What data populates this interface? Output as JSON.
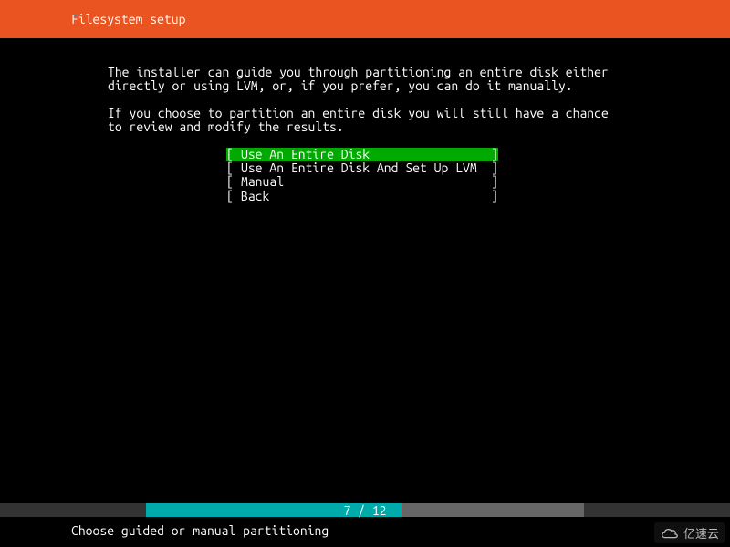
{
  "header": {
    "title": "Filesystem setup"
  },
  "body": {
    "para1": "The installer can guide you through partitioning an entire disk either\ndirectly or using LVM, or, if you prefer, you can do it manually.",
    "para2": "If you choose to partition an entire disk you will still have a chance\nto review and modify the results."
  },
  "menu": {
    "items": [
      {
        "label": "Use An Entire Disk",
        "selected": true
      },
      {
        "label": "Use An Entire Disk And Set Up LVM",
        "selected": false
      },
      {
        "label": "Manual",
        "selected": false
      },
      {
        "label": "Back",
        "selected": false
      }
    ]
  },
  "progress": {
    "current": 7,
    "total": 12,
    "text": "7 / 12"
  },
  "footer": {
    "hint": "Choose guided or manual partitioning"
  },
  "watermark": {
    "text": "亿速云"
  }
}
